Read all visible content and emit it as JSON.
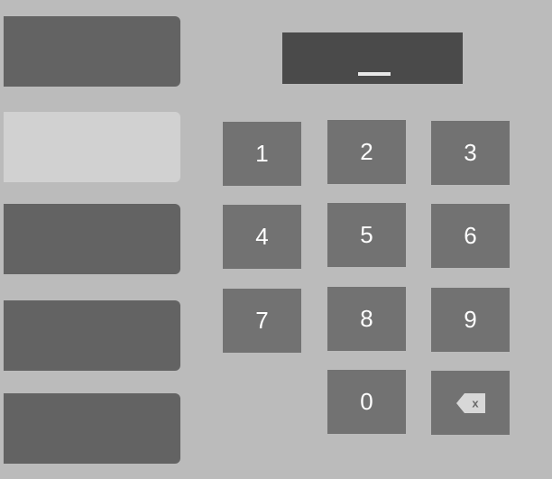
{
  "display": {
    "cursor_char": "_"
  },
  "sidebar": {
    "items": [
      {
        "selected": false
      },
      {
        "selected": true
      },
      {
        "selected": false
      },
      {
        "selected": false
      },
      {
        "selected": false
      }
    ]
  },
  "keypad": {
    "keys": [
      "1",
      "2",
      "3",
      "4",
      "5",
      "6",
      "7",
      "8",
      "9",
      "0"
    ],
    "backspace_icon": "backspace-icon",
    "backspace_mark": "x"
  },
  "colors": {
    "background": "#bbbbbb",
    "side_button": "#636363",
    "side_button_selected": "#d1d1d1",
    "display": "#4a4a4a",
    "key": "#727272",
    "key_text": "#ffffff"
  }
}
